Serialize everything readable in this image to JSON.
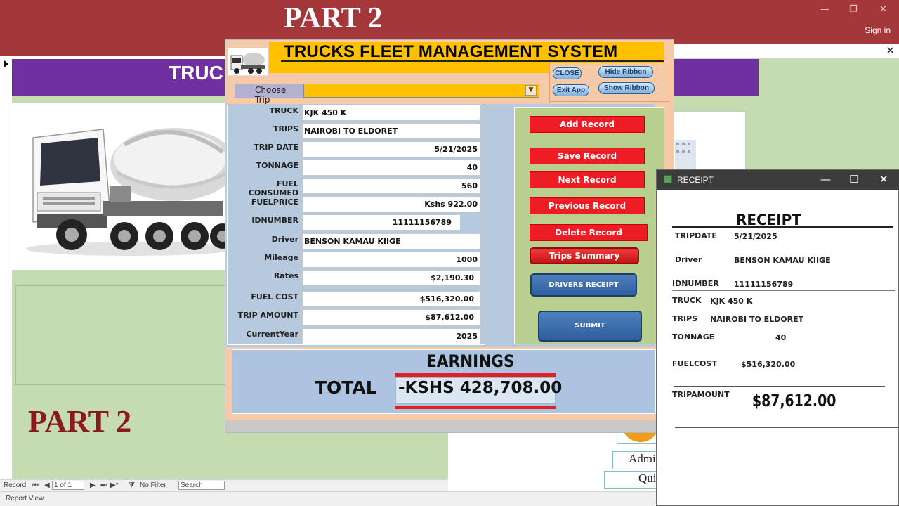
{
  "app": {
    "banner": "PART 2",
    "sign_in": "Sign in",
    "window_controls": {
      "minimize": "—",
      "restore": "❐",
      "close": "✕"
    },
    "doc_close": "✕"
  },
  "background_form": {
    "title_partial": "TRUC",
    "part_label": "PART 2",
    "admin_button": "Admi",
    "quit_button": "Qui"
  },
  "record_nav": {
    "label": "Record:",
    "first": "⏮",
    "prev": "◀",
    "position": "1 of 1",
    "next": "▶",
    "last": "⏭",
    "new": "▶*",
    "filter": "No Filter",
    "search": "Search"
  },
  "status_bar": {
    "view": "Report View"
  },
  "main_form": {
    "title": "TRUCKS FLEET MANAGEMENT SYSTEM",
    "buttons_small": {
      "close": "CLOSE",
      "exit_app": "Exit App",
      "hide_ribbon": "Hide Ribbon",
      "show_ribbon": "Show Ribbon"
    },
    "choose_trip": {
      "label": "Choose Trip",
      "value": ""
    },
    "fields": [
      {
        "label": "TRUCK",
        "value": "KJK 450 K"
      },
      {
        "label": "TRIPS",
        "value": "NAIROBI TO ELDORET"
      },
      {
        "label": "TRIP DATE",
        "value": "5/21/2025"
      },
      {
        "label": "TONNAGE",
        "value": "40"
      },
      {
        "label": "FUEL CONSUMED",
        "value": "560"
      },
      {
        "label": "FUELPRICE",
        "value": "Kshs 922.00"
      },
      {
        "label": "IDNUMBER",
        "value": "11111156789"
      },
      {
        "label": "Driver",
        "value": "BENSON KAMAU KIIGE"
      },
      {
        "label": "Mileage",
        "value": "1000"
      },
      {
        "label": "Rates",
        "value": "$2,190.30"
      },
      {
        "label": "FUEL COST",
        "value": "$516,320.00"
      },
      {
        "label": "TRIP AMOUNT",
        "value": "$87,612.00"
      },
      {
        "label": "CurrentYear",
        "value": "2025"
      }
    ],
    "action_buttons": {
      "add": "Add Record",
      "save": "Save Record",
      "next": "Next Record",
      "previous": "Previous Record",
      "delete": "Delete Record",
      "trips_summary": "Trips Summary",
      "drivers_receipt": "DRIVERS RECEIPT",
      "submit": "SUBMIT"
    },
    "earnings": {
      "heading": "EARNINGS",
      "total_label": "TOTAL",
      "total_value": "-KSHS 428,708.00"
    }
  },
  "receipt": {
    "window_title": "RECEIPT",
    "heading": "RECEIPT",
    "rows": [
      {
        "label": "TRIPDATE",
        "value": "5/21/2025"
      },
      {
        "label": "Driver",
        "value": "BENSON KAMAU KIIGE"
      },
      {
        "label": "IDNUMBER",
        "value": "11111156789"
      },
      {
        "label": "TRUCK",
        "value": "KJK 450 K"
      },
      {
        "label": "TRIPS",
        "value": "NAIROBI TO ELDORET"
      },
      {
        "label": "TONNAGE",
        "value": "40"
      },
      {
        "label": "FUELCOST",
        "value": "$516,320.00"
      },
      {
        "label": "TRIPAMOUNT",
        "value": "$87,612.00"
      }
    ]
  },
  "colors": {
    "title_bar": "#a4373a",
    "form_green": "#c5dbb0",
    "purple_band": "#7030a0",
    "form_title_bg": "#ffc000",
    "popup_bg": "#f5caa8",
    "fields_bg": "#b7c9dd",
    "red_button": "#ee1c25",
    "blue_button": "#2f5e9e"
  },
  "icons": [
    "truck-mixer-image",
    "receipt-app-icon",
    "dropdown-caret-icon"
  ]
}
